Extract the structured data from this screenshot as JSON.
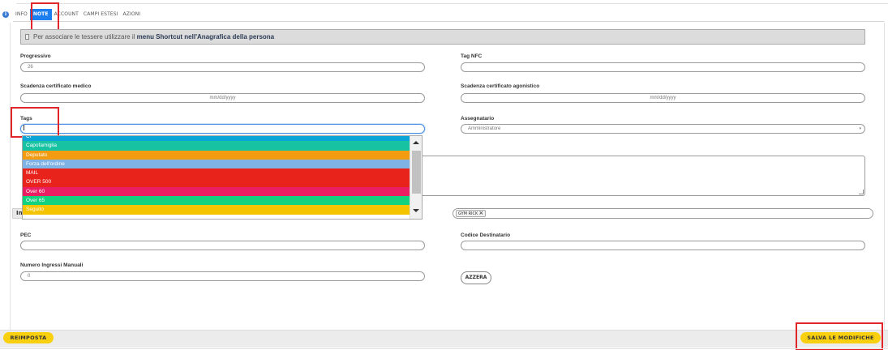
{
  "tabs": [
    "INFO",
    "NOTE",
    "ACCOUNT",
    "CAMPI ESTESI",
    "AZIONI"
  ],
  "notice": {
    "text": "Per associare le tessere utilizzare il",
    "bold": "menu Shortcut nell'Anagrafica della persona"
  },
  "fields": {
    "progressivo": {
      "label": "Progressivo",
      "value": "26"
    },
    "tag_nfc": {
      "label": "Tag NFC",
      "value": ""
    },
    "scadenza_medico": {
      "label": "Scadenza certificato medico",
      "placeholder": "mm/dd/yyyy"
    },
    "scadenza_agonistico": {
      "label": "Scadenza certificato agonistico",
      "placeholder": "mm/dd/yyyy"
    },
    "tags": {
      "label": "Tags",
      "value": ""
    },
    "assegnatario": {
      "label": "Assegnatario",
      "value": "Amministratore"
    },
    "pec": {
      "label": "PEC",
      "value": ""
    },
    "codice_destinatario": {
      "label": "Codice Destinatario",
      "value": ""
    },
    "numero_ingressi": {
      "label": "Numero Ingressi Manuali",
      "value": "0"
    }
  },
  "strip_label": "In",
  "selected_chip": "GYM RICK",
  "dropdown": [
    {
      "label": "Cl",
      "color": "#0aa5d6"
    },
    {
      "label": "Capofamiglia",
      "color": "#17c2a3"
    },
    {
      "label": "Deputato",
      "color": "#f39c12"
    },
    {
      "label": "Forza dell'ordine",
      "color": "#7fb3e6"
    },
    {
      "label": "MAIL",
      "color": "#e8231b"
    },
    {
      "label": "OVER 500",
      "color": "#e8231b"
    },
    {
      "label": "Over 60",
      "color": "#e91e63"
    },
    {
      "label": "Over 65",
      "color": "#12d17f"
    },
    {
      "label": "Seguito",
      "color": "#f5c400"
    }
  ],
  "buttons": {
    "azzera": "AZZERA",
    "reimposta": "REIMPOSTA",
    "salva": "SALVA LE MODIFICHE"
  },
  "colors": {
    "accent": "#1d7ef0",
    "highlight": "#e0262a",
    "button_yellow": "#f9d00f"
  }
}
